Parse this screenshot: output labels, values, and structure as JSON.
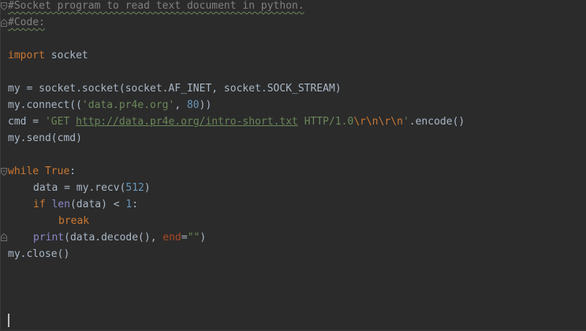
{
  "editor": {
    "language": "python",
    "lines": {
      "l1": {
        "comment": "#Socket program to read text document in python."
      },
      "l2": {
        "comment": "#Code:"
      },
      "l4": {
        "kw": "import",
        "rest": " socket"
      },
      "l6": {
        "text": "my = socket.socket(socket.AF_INET, socket.SOCK_STREAM)"
      },
      "l7": {
        "pre": "my.connect((",
        "str": "'data.pr4e.org'",
        "sep": ", ",
        "num": "80",
        "post": "))"
      },
      "l8": {
        "pre": "cmd = ",
        "str_open": "'GET ",
        "url": "http://data.pr4e.org/intro-short.txt",
        "str_mid": " HTTP/1.0",
        "esc": "\\r\\n\\r\\n",
        "str_close": "'",
        "post": ".encode()"
      },
      "l9": {
        "text": "my.send(cmd)"
      },
      "l11": {
        "kw": "while",
        "sp": " ",
        "kw2": "True",
        "post": ":"
      },
      "l12": {
        "pre": "data = my.recv(",
        "num": "512",
        "post": ")"
      },
      "l13": {
        "kw": "if",
        "sp": " ",
        "bi": "len",
        "mid": "(data) < ",
        "num": "1",
        "post": ":"
      },
      "l14": {
        "kw": "break"
      },
      "l15": {
        "bi": "print",
        "mid": "(data.decode(), ",
        "named": "end",
        "eq": "=",
        "str": "\"\"",
        "post": ")"
      },
      "l16": {
        "text": "my.close()"
      }
    }
  },
  "colors": {
    "background": "#2b2b2b",
    "default_text": "#a9b7c6",
    "keyword": "#cc7832",
    "string": "#6a8759",
    "number": "#6897bb",
    "builtin": "#8888c6",
    "comment": "#808080",
    "named_arg": "#aa4926"
  },
  "icons": {
    "fold_open": "fold-collapse-icon",
    "fold_end": "fold-end-icon"
  }
}
